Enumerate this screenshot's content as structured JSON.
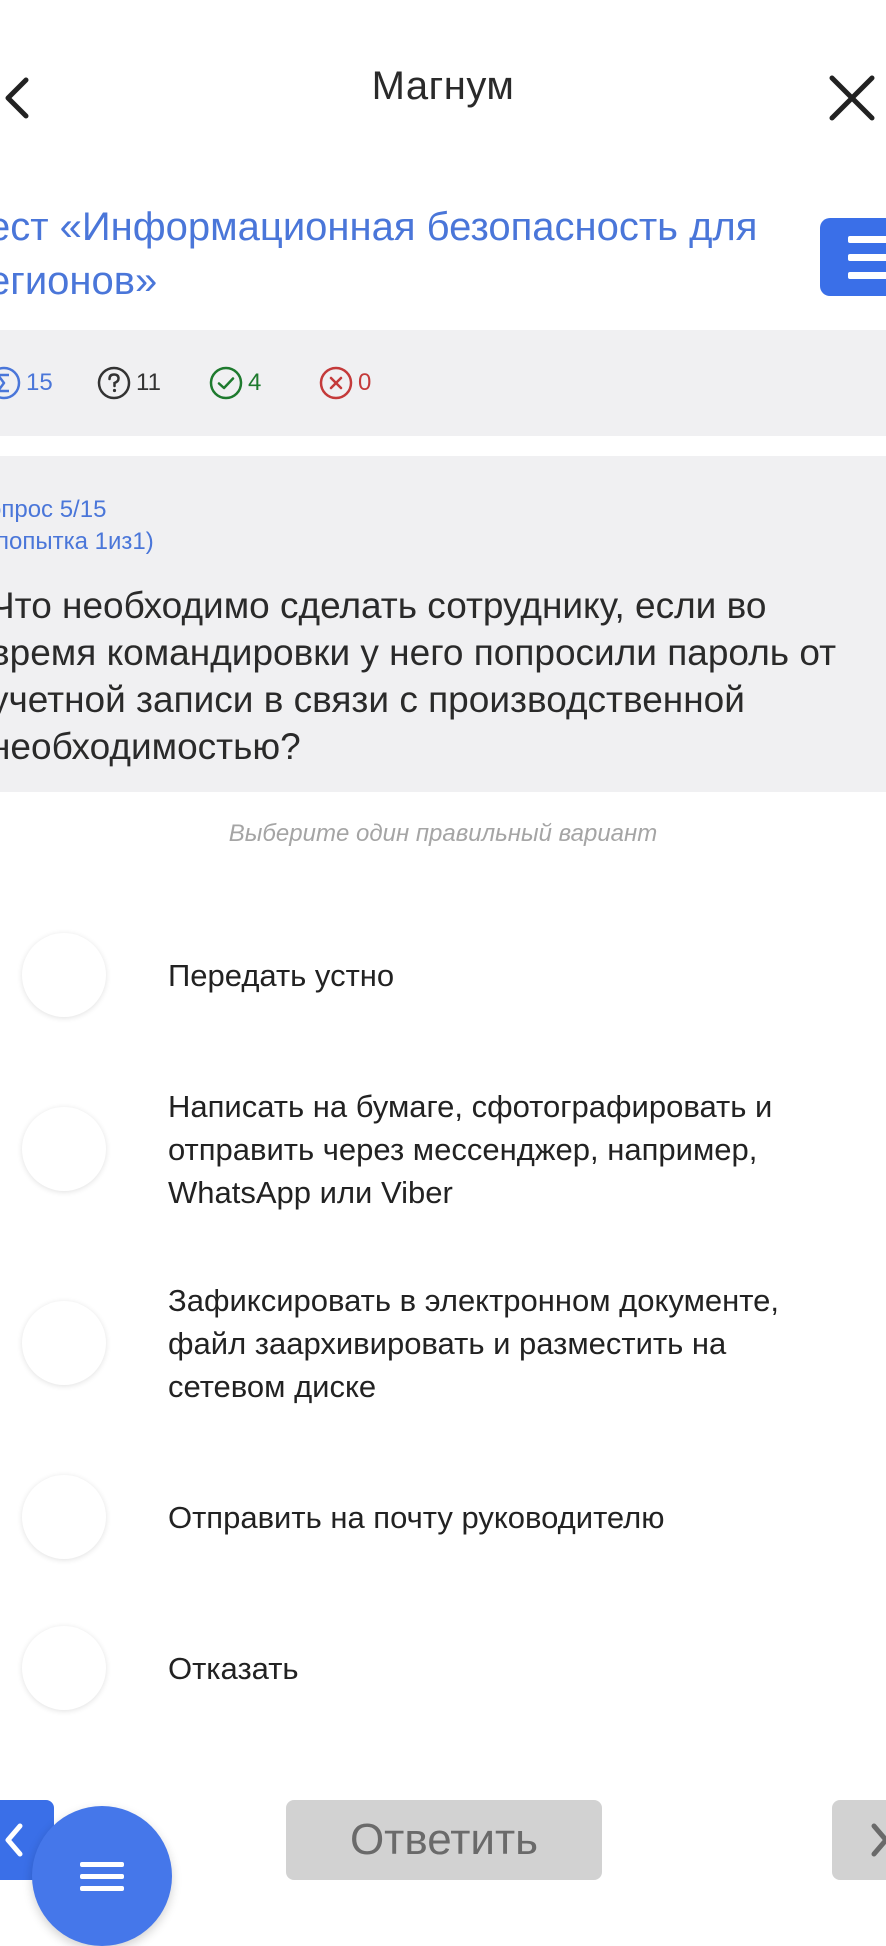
{
  "header": {
    "title": "Магнум",
    "back_icon": "chevron-left-icon",
    "close_icon": "close-icon"
  },
  "test": {
    "title_lines": [
      "ест «Информационная безопасность для",
      "егионов»"
    ],
    "menu_icon": "hamburger-menu-icon"
  },
  "stats": {
    "total": "15",
    "unanswered": "11",
    "correct": "4",
    "wrong": "0"
  },
  "question": {
    "number": "опрос 5/15",
    "attempt": "(попытка 1из1)",
    "text_lines": [
      "Что необходимо сделать сотруднику, если во",
      "время командировки у него попросили пароль от",
      "учетной записи в связи с производственной",
      "необходимостью?"
    ]
  },
  "instruction": "Выберите один правильный вариант",
  "options": [
    {
      "lines": [
        "Передать устно"
      ]
    },
    {
      "lines": [
        "Написать на бумаге, сфотографировать и",
        "отправить через мессенджер, например,",
        "WhatsApp или Viber"
      ]
    },
    {
      "lines": [
        "Зафиксировать в электронном документе,",
        "файл заархивировать и разместить на",
        "сетевом диске"
      ]
    },
    {
      "lines": [
        "Отправить на почту руководителю"
      ]
    },
    {
      "lines": [
        "Отказать"
      ]
    }
  ],
  "footer": {
    "answer_label": "Ответить",
    "prev_icon": "chevron-left-icon",
    "next_icon": "chevron-right-icon",
    "fab_icon": "menu-icon"
  },
  "colors": {
    "accent": "#3a6fe8",
    "link": "#4a76d9",
    "correct": "#1e7a2e",
    "wrong": "#c43a3a",
    "panel": "#f0f0f2",
    "disabled_button": "#d2d2d2"
  }
}
